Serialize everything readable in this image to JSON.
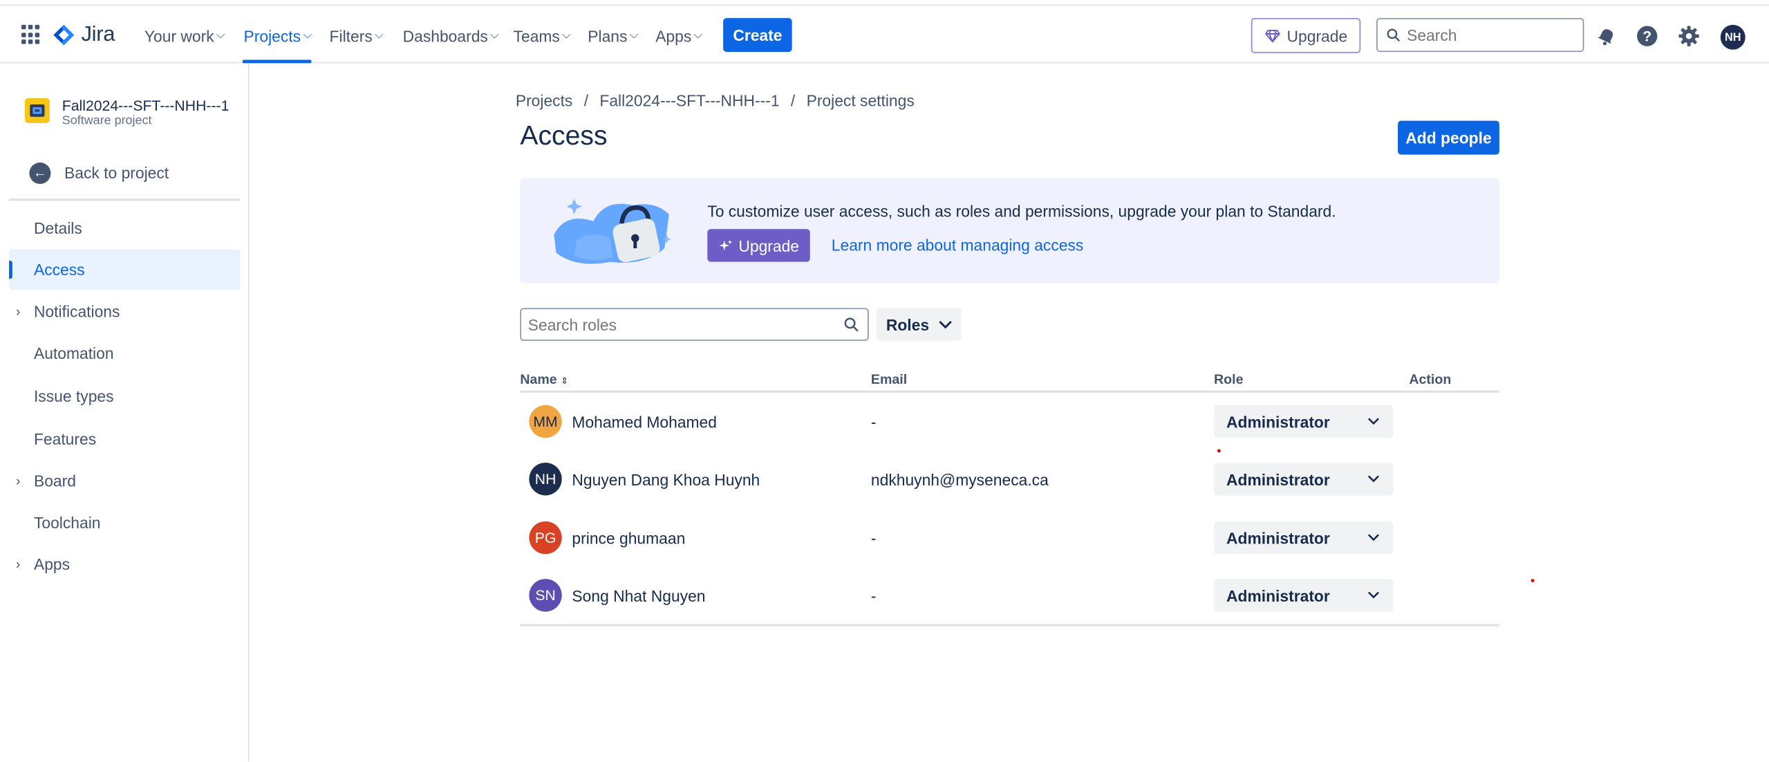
{
  "topnav": {
    "logo_text": "Jira",
    "items": [
      {
        "label": "Your work",
        "active": false
      },
      {
        "label": "Projects",
        "active": true
      },
      {
        "label": "Filters",
        "active": false
      },
      {
        "label": "Dashboards",
        "active": false
      },
      {
        "label": "Teams",
        "active": false
      },
      {
        "label": "Plans",
        "active": false
      },
      {
        "label": "Apps",
        "active": false
      }
    ],
    "create_label": "Create",
    "upgrade_label": "Upgrade",
    "search_placeholder": "Search",
    "user_initials": "NH",
    "icons": [
      "app-switcher-icon",
      "notifications-icon",
      "help-icon",
      "settings-icon"
    ]
  },
  "sidebar": {
    "project_name": "Fall2024---SFT---NHH---1",
    "project_type": "Software project",
    "back_label": "Back to project",
    "items": [
      {
        "label": "Details",
        "expandable": false,
        "active": false
      },
      {
        "label": "Access",
        "expandable": false,
        "active": true
      },
      {
        "label": "Notifications",
        "expandable": true,
        "active": false
      },
      {
        "label": "Automation",
        "expandable": false,
        "active": false
      },
      {
        "label": "Issue types",
        "expandable": false,
        "active": false
      },
      {
        "label": "Features",
        "expandable": false,
        "active": false
      },
      {
        "label": "Board",
        "expandable": true,
        "active": false
      },
      {
        "label": "Toolchain",
        "expandable": false,
        "active": false
      },
      {
        "label": "Apps",
        "expandable": true,
        "active": false
      }
    ]
  },
  "main": {
    "breadcrumbs": [
      "Projects",
      "Fall2024---SFT---NHH---1",
      "Project settings"
    ],
    "breadcrumb_sep": "/",
    "title": "Access",
    "add_people_label": "Add people",
    "banner": {
      "text": "To customize user access, such as roles and permissions, upgrade your plan to Standard.",
      "upgrade_label": "Upgrade",
      "link_label": "Learn more about managing access"
    },
    "search_roles_placeholder": "Search roles",
    "roles_filter_label": "Roles",
    "table": {
      "headers": {
        "name": "Name",
        "email": "Email",
        "role": "Role",
        "action": "Action"
      },
      "rows": [
        {
          "initials": "MM",
          "avatar_color": "#f0a541",
          "avatar_text_color": "#172b4d",
          "name": "Mohamed Mohamed",
          "email": "-",
          "role": "Administrator"
        },
        {
          "initials": "NH",
          "avatar_color": "#1d2d4f",
          "avatar_text_color": "#ffffff",
          "name": "Nguyen Dang Khoa Huynh",
          "email": "ndkhuynh@myseneca.ca",
          "role": "Administrator"
        },
        {
          "initials": "PG",
          "avatar_color": "#d84325",
          "avatar_text_color": "#ffffff",
          "name": "prince ghumaan",
          "email": "-",
          "role": "Administrator"
        },
        {
          "initials": "SN",
          "avatar_color": "#5e4db2",
          "avatar_text_color": "#ffffff",
          "name": "Song Nhat Nguyen",
          "email": "-",
          "role": "Administrator"
        }
      ]
    }
  },
  "colors": {
    "brand": "#0c66e4",
    "upgrade_purple": "#6e5dc6",
    "banner_bg": "#f0f1fe"
  }
}
